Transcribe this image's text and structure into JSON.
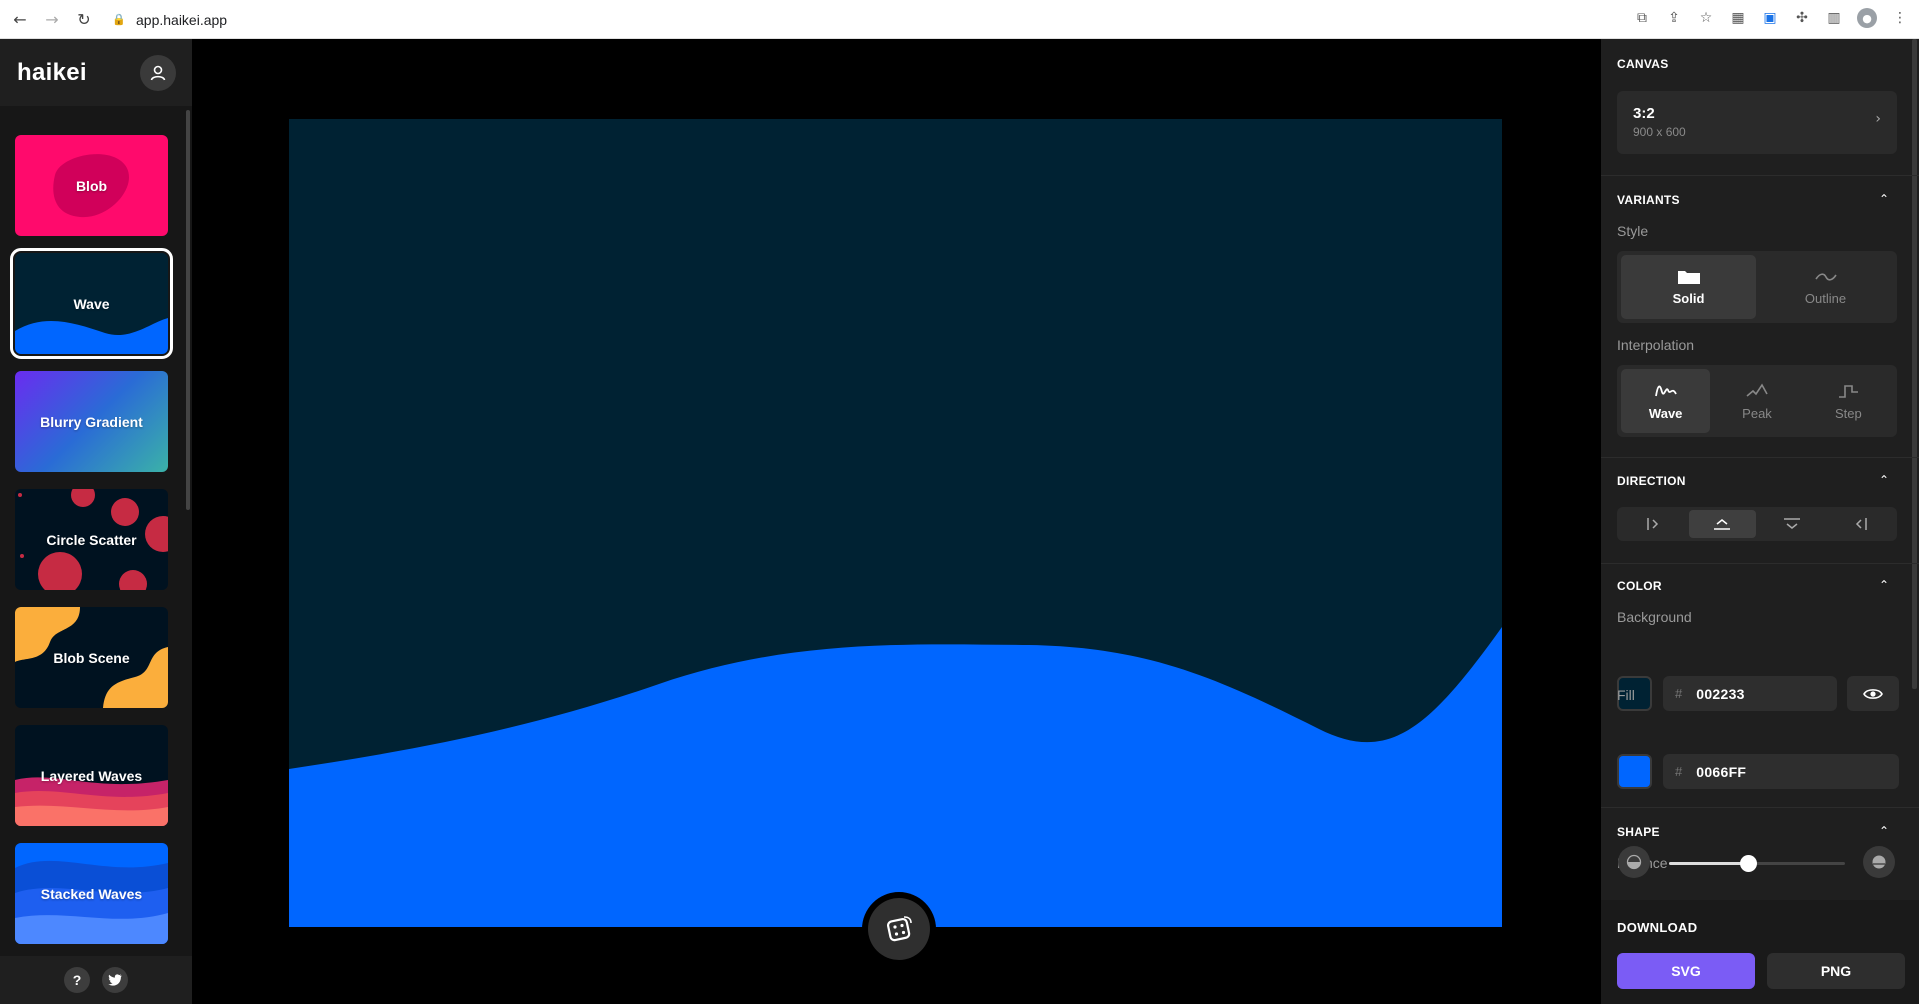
{
  "browser": {
    "url": "app.haikei.app"
  },
  "app": {
    "logo": "haikei"
  },
  "generators": [
    {
      "label": "Blob",
      "bg": "#FF0066"
    },
    {
      "label": "Wave",
      "bg": "#002233",
      "selected": true
    },
    {
      "label": "Blurry Gradient",
      "bg": "#5B3FF0"
    },
    {
      "label": "Circle Scatter",
      "bg": "#001220"
    },
    {
      "label": "Blob Scene",
      "bg": "#001220"
    },
    {
      "label": "Layered Waves",
      "bg": "#001220"
    },
    {
      "label": "Stacked Waves",
      "bg": "#0066FF"
    }
  ],
  "footer": {
    "help_glyph": "?"
  },
  "canvas_panel": {
    "title": "CANVAS",
    "ratio": "3:2",
    "dimensions": "900 x 600"
  },
  "variants": {
    "title": "VARIANTS",
    "style_label": "Style",
    "styles": [
      {
        "label": "Solid",
        "active": true
      },
      {
        "label": "Outline",
        "active": false
      }
    ],
    "interpolation_label": "Interpolation",
    "interpolations": [
      {
        "label": "Wave",
        "active": true
      },
      {
        "label": "Peak",
        "active": false
      },
      {
        "label": "Step",
        "active": false
      }
    ]
  },
  "direction": {
    "title": "DIRECTION",
    "options": [
      "right",
      "up",
      "down",
      "left"
    ],
    "active": "up"
  },
  "color": {
    "title": "COLOR",
    "background_label": "Background",
    "background_hex": "002233",
    "fill_label": "Fill",
    "fill_hex": "0066FF",
    "hash": "#"
  },
  "shape": {
    "title": "SHAPE",
    "balance_label": "Balance",
    "balance_value": 0.45
  },
  "download": {
    "title": "DOWNLOAD",
    "svg_label": "SVG",
    "png_label": "PNG"
  },
  "colors": {
    "accent": "#7B5CF5",
    "wave_fill": "#0066FF",
    "wave_bg": "#002233"
  }
}
